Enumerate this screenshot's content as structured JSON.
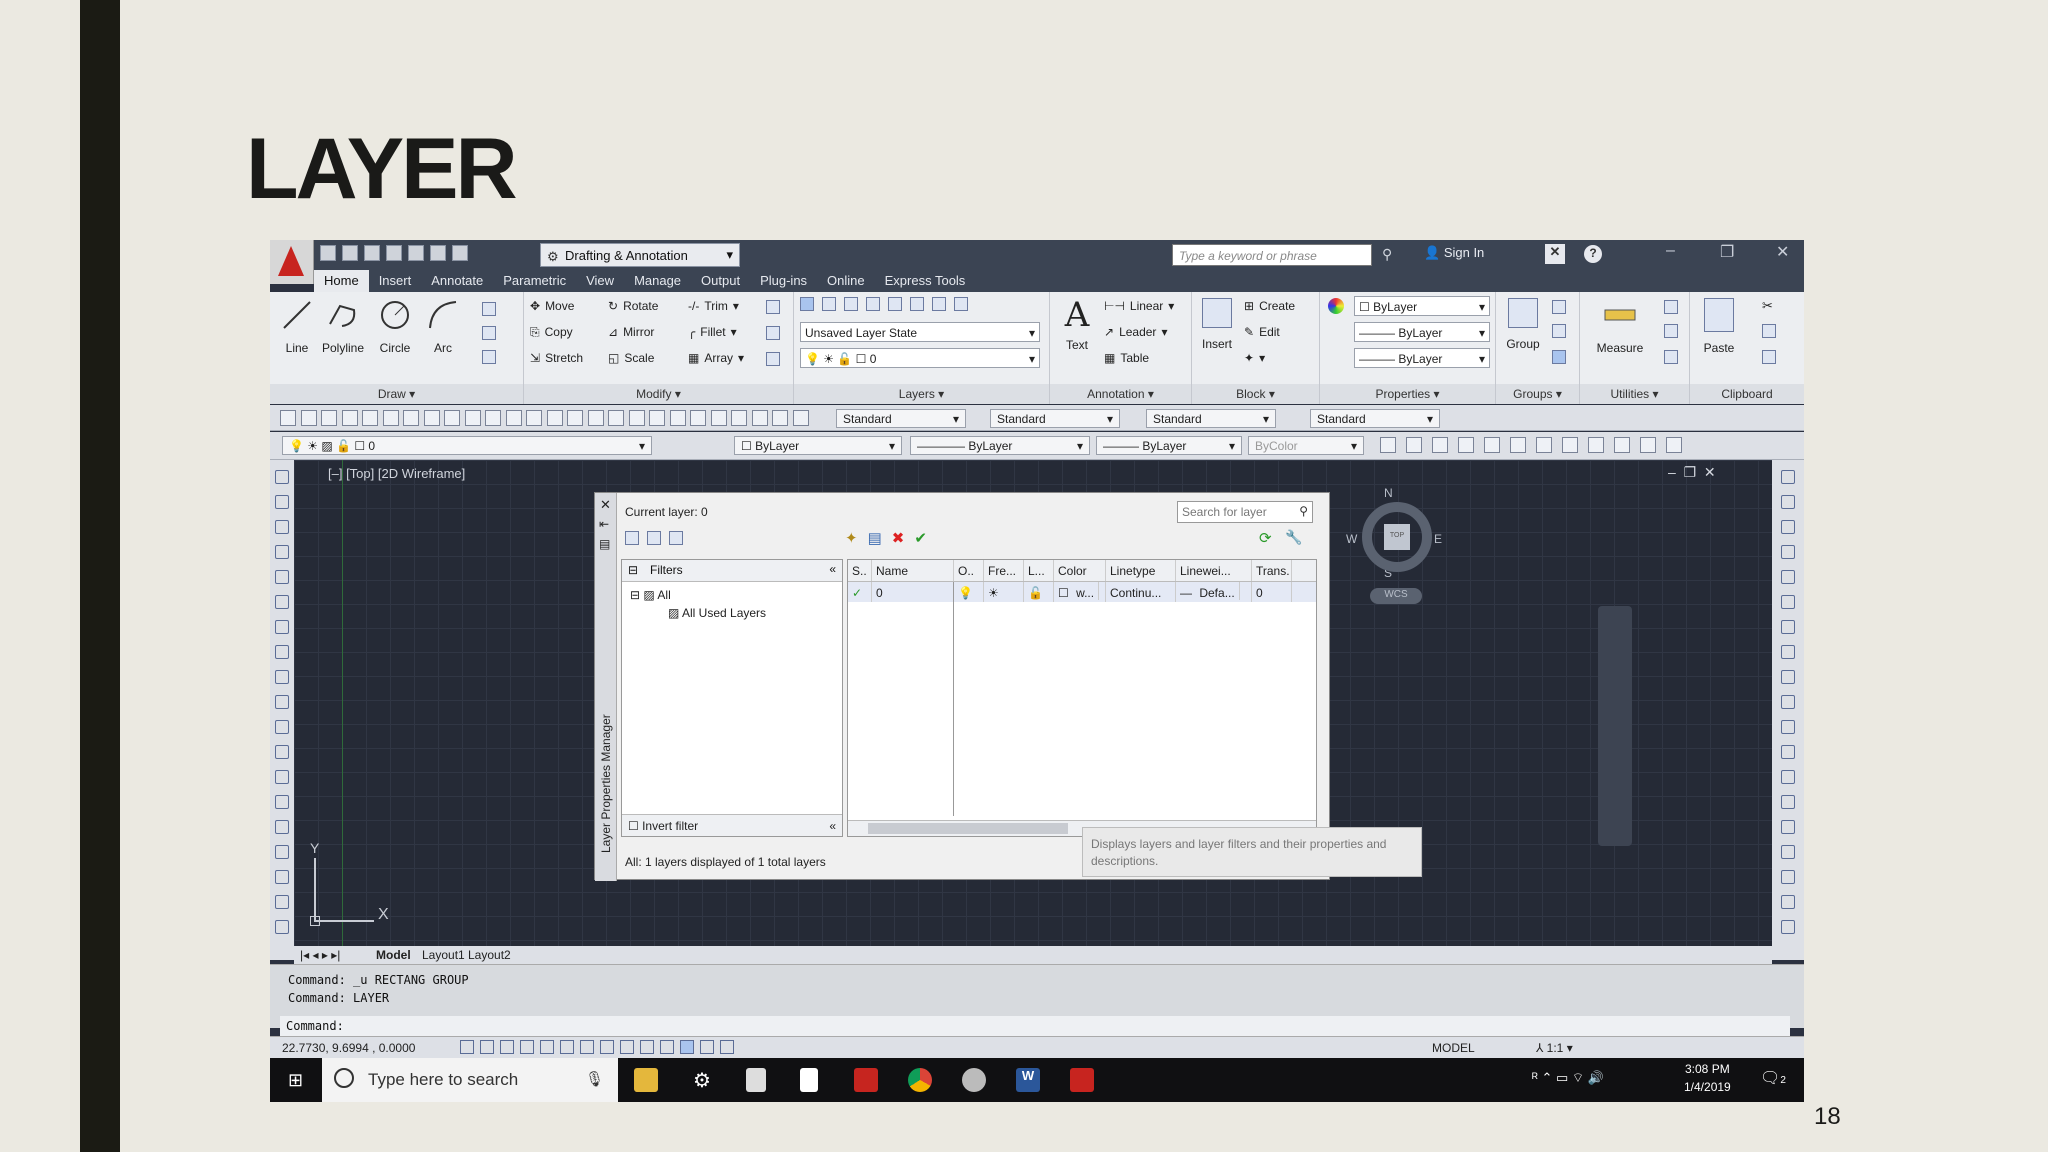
{
  "slide": {
    "title": "LAYER",
    "page_number": "18"
  },
  "app": {
    "workspace": "Drafting & Annotation",
    "search_placeholder": "Type a keyword or phrase",
    "sign_in": "Sign In",
    "menu": [
      "Home",
      "Insert",
      "Annotate",
      "Parametric",
      "View",
      "Manage",
      "Output",
      "Plug-ins",
      "Online",
      "Express Tools"
    ],
    "active_menu": "Home"
  },
  "ribbon": {
    "draw": {
      "label": "Draw",
      "tools": [
        "Line",
        "Polyline",
        "Circle",
        "Arc"
      ]
    },
    "modify": {
      "label": "Modify",
      "tools": [
        "Move",
        "Rotate",
        "Trim",
        "Copy",
        "Mirror",
        "Fillet",
        "Stretch",
        "Scale",
        "Array"
      ]
    },
    "layers": {
      "label": "Layers",
      "layer_state": "Unsaved Layer State",
      "current": "0"
    },
    "annotation": {
      "label": "Annotation",
      "text": "Text",
      "linear": "Linear",
      "leader": "Leader",
      "table": "Table"
    },
    "block": {
      "label": "Block",
      "insert": "Insert",
      "create": "Create",
      "edit": "Edit"
    },
    "properties": {
      "label": "Properties",
      "color": "ByLayer",
      "linetype": "ByLayer",
      "lineweight": "ByLayer"
    },
    "groups": {
      "label": "Groups",
      "group": "Group"
    },
    "utilities": {
      "label": "Utilities",
      "measure": "Measure"
    },
    "clipboard": {
      "label": "Clipboard",
      "paste": "Paste"
    }
  },
  "toolbars": {
    "styles": [
      "Standard",
      "Standard",
      "Standard",
      "Standard"
    ],
    "layer_combo": "0",
    "prop_color": "ByLayer",
    "prop_linetype": "ByLayer",
    "prop_lineweight": "ByLayer",
    "plot_style": "ByColor"
  },
  "viewport": {
    "label": "[–] [Top] [2D Wireframe]",
    "compass": {
      "n": "N",
      "s": "S",
      "e": "E",
      "w": "W",
      "top": "TOP",
      "wcs": "WCS"
    },
    "ucs": {
      "x": "X",
      "y": "Y"
    }
  },
  "layer_manager": {
    "side_title": "Layer Properties Manager",
    "current_layer": "Current layer: 0",
    "search_placeholder": "Search for layer",
    "filters_label": "Filters",
    "tree": [
      "All",
      "All Used Layers"
    ],
    "invert_filter": "Invert filter",
    "columns": [
      "S..",
      "Name",
      "O..",
      "Fre...",
      "L...",
      "Color",
      "Linetype",
      "Linewei...",
      "Trans."
    ],
    "row": {
      "status": "✓",
      "name": "0",
      "color": "w...",
      "linetype": "Continu...",
      "lineweight": "Defa...",
      "transparency": "0"
    },
    "footer": "All: 1 layers displayed of 1 total layers",
    "tooltip": "Displays layers and layer filters and their properties and descriptions."
  },
  "tabs": [
    "Model",
    "Layout1",
    "Layout2"
  ],
  "command_history": [
    "Command: _u RECTANG GROUP",
    "Command: LAYER"
  ],
  "command_prompt": "Command:",
  "status": {
    "coords": "22.7730, 9.6994 , 0.0000",
    "model": "MODEL",
    "scale": "1:1"
  },
  "taskbar": {
    "search": "Type here to search",
    "time": "3:08 PM",
    "date": "1/4/2019",
    "notifications": "2"
  },
  "colors": {
    "autocad_red": "#c7241f",
    "dark_ui": "#3b4453",
    "viewport_bg": "#252a36"
  }
}
